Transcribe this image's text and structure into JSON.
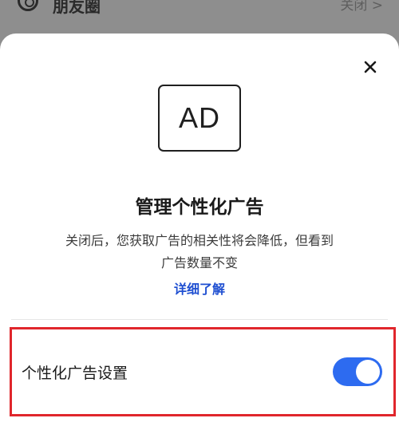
{
  "background": {
    "item_label": "朋友圈",
    "item_action": "关闭 >"
  },
  "dialog": {
    "ad_badge": "AD",
    "title": "管理个性化广告",
    "description_line1": "关闭后，您获取广告的相关性将会降低，但看到",
    "description_line2": "广告数量不变",
    "learn_more": "详细了解",
    "setting": {
      "label": "个性化广告设置",
      "enabled": true
    }
  },
  "colors": {
    "accent": "#2d6bf0",
    "link": "#1f4fd1",
    "highlight_border": "#e0262c"
  }
}
